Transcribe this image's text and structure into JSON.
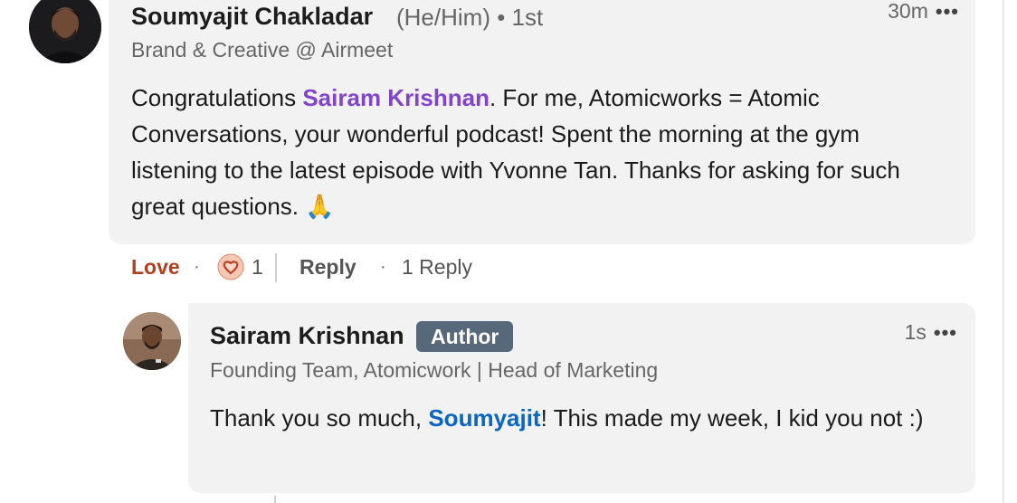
{
  "comment": {
    "author_name": "Soumyajit Chakladar",
    "pronouns": "(He/Him)",
    "connection": "• 1st",
    "headline": "Brand & Creative @ Airmeet",
    "timestamp": "30m",
    "more_icon": "•••",
    "text_before_mention": "Congratulations ",
    "mention": "Sairam Krishnan",
    "text_after_mention": ". For me, Atomicworks = Atomic Conversations, your wonderful podcast! Spent the morning at the gym listening to the latest episode with Yvonne Tan. Thanks for asking for such great questions. ",
    "emoji": "🙏",
    "accent_color": "#8344cc"
  },
  "actions": {
    "love_label": "Love",
    "separator": "·",
    "reaction_count": "1",
    "reply_label": "Reply",
    "reply_count": "1 Reply",
    "love_color": "#b24020"
  },
  "reply": {
    "author_name": "Sairam Krishnan",
    "badge": "Author",
    "headline": "Founding Team, Atomicwork | Head of Marketing",
    "timestamp": "1s",
    "more_icon": "•••",
    "text_before_mention": "Thank you so much, ",
    "mention": "Soumyajit",
    "text_after_mention": "! This made my week, I kid you not :)",
    "accent_color": "#0a66c2",
    "badge_color": "#56687a"
  }
}
